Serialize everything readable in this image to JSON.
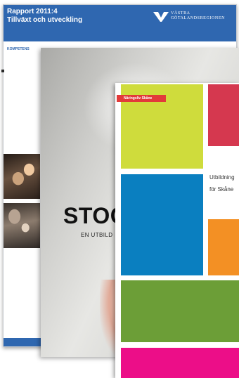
{
  "report": {
    "number": "Rapport 2011:4",
    "title": "Tillväxt och utveckling",
    "band_text": "KOMPETENS",
    "logo_text_line1": "VÄSTRA",
    "logo_text_line2": "GÖTALANDSREGIONEN"
  },
  "stockholm": {
    "title": "STOC",
    "subtitle": "EN UTBILD"
  },
  "skane": {
    "tag": "Näringsliv Skåne",
    "text_line1": "Utbildning",
    "text_line2": "för Skåne"
  },
  "colors": {
    "report_blue": "#2f67b0",
    "lime": "#cfdc3c",
    "red": "#d5384f",
    "blue": "#0a7fc0",
    "orange": "#f39024",
    "green": "#6c9e37",
    "pink": "#ec0e88"
  }
}
